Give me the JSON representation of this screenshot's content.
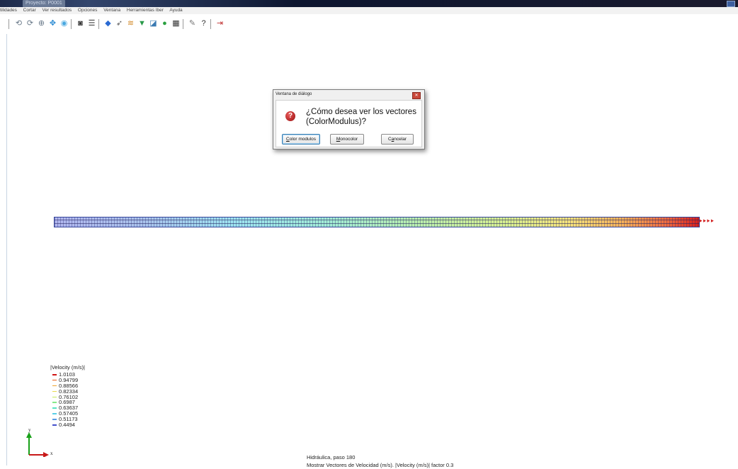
{
  "window": {
    "title": "Proyecto: P0001"
  },
  "menu": [
    "tilidades",
    "Cortar",
    "Ver resultados",
    "Opciones",
    "Ventana",
    "Herramientas Iber",
    "Ayuda"
  ],
  "toolbar": [
    "rotate-icon",
    "rotate-screen-icon",
    "zoom-icon",
    "pan-icon",
    "sphere-icon",
    "render-icon",
    "print-icon",
    "contour-fill-icon",
    "vectors-icon",
    "layers-icon",
    "flow-icon",
    "graph-icon",
    "result-icon",
    "animate-icon",
    "settings-icon",
    "help-icon",
    "exit-icon"
  ],
  "dialog": {
    "title": "Ventana de diálogo",
    "message": "¿Cómo desea ver los vectores (ColorModulus)?",
    "buttons": {
      "color": {
        "accel": "C",
        "rest": "olor modulos"
      },
      "mono": {
        "accel": "M",
        "rest": "onocolor"
      },
      "cancel": {
        "pre": "C",
        "accel": "a",
        "rest": "ncelar"
      }
    }
  },
  "legend": {
    "title": "|Velocity (m/s)|",
    "entries": [
      {
        "value": "1.0103",
        "color": "#d01414"
      },
      {
        "value": "0.94799",
        "color": "#e86018"
      },
      {
        "value": "0.88566",
        "color": "#eea430"
      },
      {
        "value": "0.82334",
        "color": "#e9da4a"
      },
      {
        "value": "0.76102",
        "color": "#c4ea5c"
      },
      {
        "value": "0.6987",
        "color": "#86e888"
      },
      {
        "value": "0.63637",
        "color": "#58e2c2"
      },
      {
        "value": "0.57405",
        "color": "#58cfe8"
      },
      {
        "value": "0.51173",
        "color": "#5a9ce4"
      },
      {
        "value": "0.4494",
        "color": "#4450cc"
      }
    ]
  },
  "axes": {
    "x": "x",
    "y": "y"
  },
  "footer": {
    "line1": "Hidráulica, paso 180",
    "line2": "Mostrar Vectores de Velocidad (m/s). |Velocity (m/s)| factor 0.3"
  }
}
